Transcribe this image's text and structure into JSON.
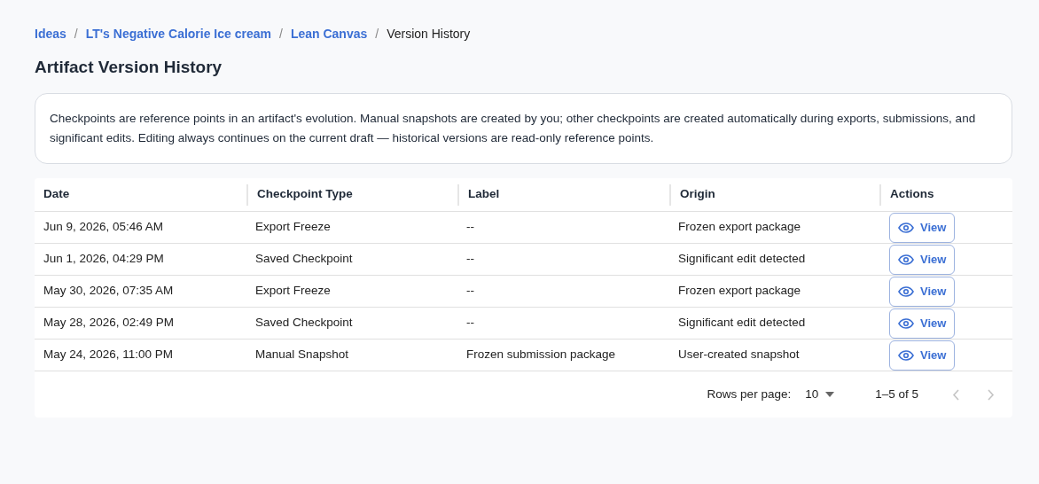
{
  "breadcrumb": [
    {
      "label": "Ideas",
      "link": true
    },
    {
      "label": "LT's Negative Calorie Ice cream",
      "link": true
    },
    {
      "label": "Lean Canvas",
      "link": true
    },
    {
      "label": "Version History",
      "link": false
    }
  ],
  "breadcrumb_separator": "/",
  "title": "Artifact Version History",
  "info": "Checkpoints are reference points in an artifact's evolution. Manual snapshots are created by you; other checkpoints are created automatically during exports, submissions, and significant edits. Editing always continues on the current draft — historical versions are read-only reference points.",
  "table": {
    "columns": [
      "Date",
      "Checkpoint Type",
      "Label",
      "Origin",
      "Actions"
    ],
    "rows": [
      {
        "date": "Jun 9, 2026, 05:46 AM",
        "type": "Export Freeze",
        "label": "--",
        "origin": "Frozen export package",
        "action": "View"
      },
      {
        "date": "Jun 1, 2026, 04:29 PM",
        "type": "Saved Checkpoint",
        "label": "--",
        "origin": "Significant edit detected",
        "action": "View"
      },
      {
        "date": "May 30, 2026, 07:35 AM",
        "type": "Export Freeze",
        "label": "--",
        "origin": "Frozen export package",
        "action": "View"
      },
      {
        "date": "May 28, 2026, 02:49 PM",
        "type": "Saved Checkpoint",
        "label": "--",
        "origin": "Significant edit detected",
        "action": "View"
      },
      {
        "date": "May 24, 2026, 11:00 PM",
        "type": "Manual Snapshot",
        "label": "Frozen submission package",
        "origin": "User-created snapshot",
        "action": "View"
      }
    ]
  },
  "pagination": {
    "rows_per_page_label": "Rows per page:",
    "rows_per_page": "10",
    "range": "1–5 of 5",
    "previous_disabled": true,
    "next_disabled": true
  }
}
